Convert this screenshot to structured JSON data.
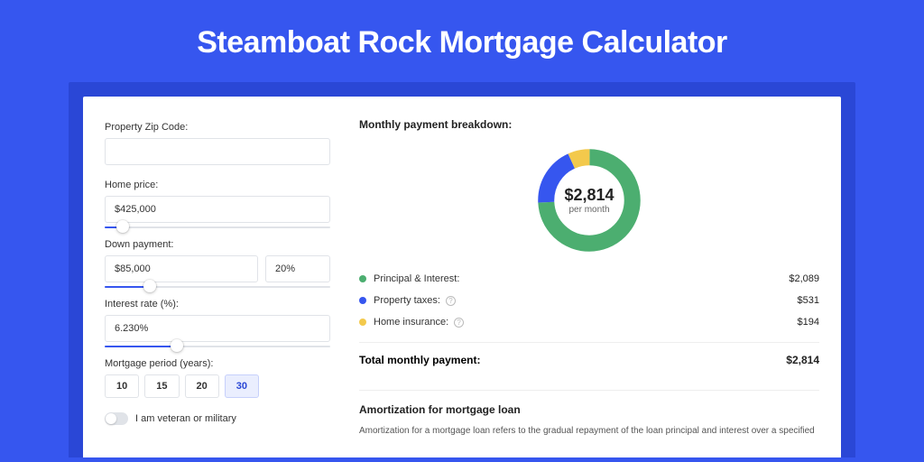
{
  "page": {
    "title": "Steamboat Rock Mortgage Calculator"
  },
  "form": {
    "zip": {
      "label": "Property Zip Code:",
      "value": ""
    },
    "home_price": {
      "label": "Home price:",
      "value": "$425,000",
      "slider_pct": 8
    },
    "down_payment": {
      "label": "Down payment:",
      "amount": "$85,000",
      "pct": "20%",
      "slider_pct": 20
    },
    "interest_rate": {
      "label": "Interest rate (%):",
      "value": "6.230%",
      "slider_pct": 32
    },
    "mortgage_period": {
      "label": "Mortgage period (years):",
      "options": [
        "10",
        "15",
        "20",
        "30"
      ],
      "selected": "30"
    },
    "veteran": {
      "label": "I am veteran or military",
      "on": false
    }
  },
  "breakdown": {
    "title": "Monthly payment breakdown:",
    "center_amount": "$2,814",
    "center_sub": "per month",
    "items": [
      {
        "key": "principal_interest",
        "label": "Principal & Interest:",
        "value": "$2,089",
        "color": "#4cae70",
        "info": false
      },
      {
        "key": "property_taxes",
        "label": "Property taxes:",
        "value": "$531",
        "color": "#3656ef",
        "info": true
      },
      {
        "key": "home_insurance",
        "label": "Home insurance:",
        "value": "$194",
        "color": "#f3c94c",
        "info": true
      }
    ],
    "total_label": "Total monthly payment:",
    "total_value": "$2,814"
  },
  "amortization": {
    "title": "Amortization for mortgage loan",
    "body": "Amortization for a mortgage loan refers to the gradual repayment of the loan principal and interest over a specified"
  },
  "chart_data": {
    "type": "pie",
    "title": "Monthly payment breakdown",
    "series": [
      {
        "name": "Principal & Interest",
        "value": 2089,
        "color": "#4cae70"
      },
      {
        "name": "Property taxes",
        "value": 531,
        "color": "#3656ef"
      },
      {
        "name": "Home insurance",
        "value": 194,
        "color": "#f3c94c"
      }
    ],
    "total": 2814,
    "unit": "USD/month"
  }
}
